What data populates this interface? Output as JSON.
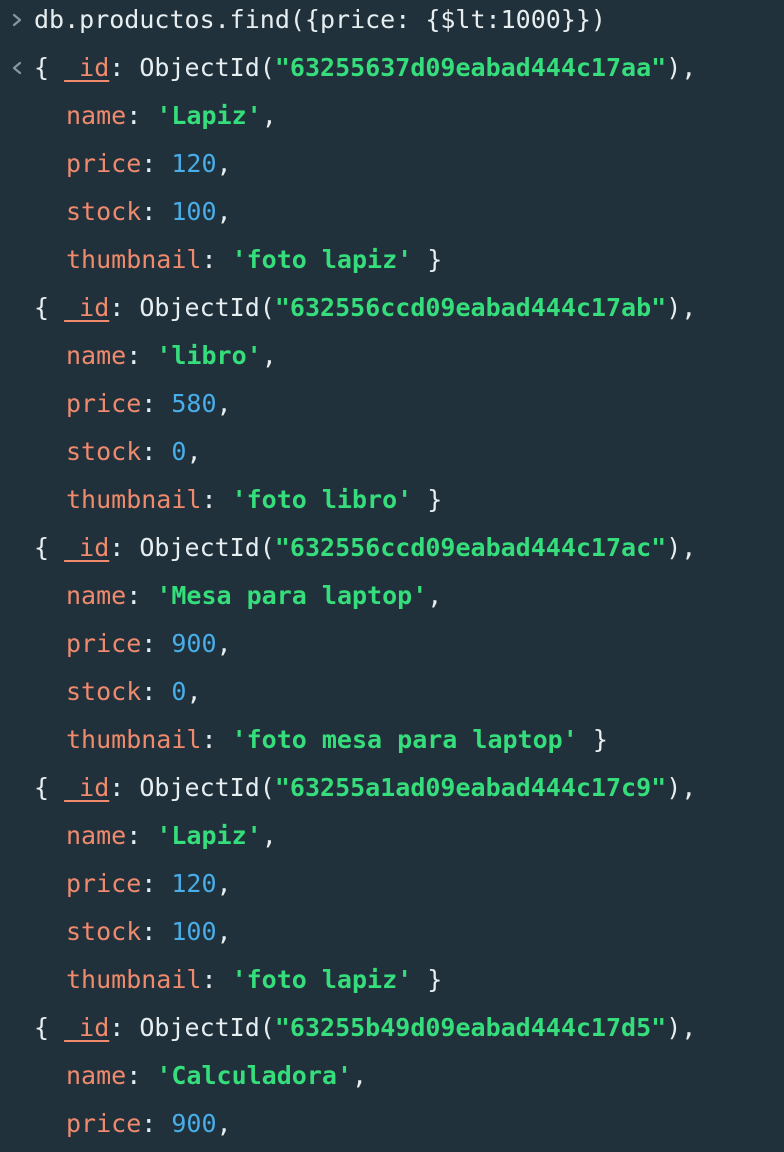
{
  "command": "db.productos.find({price: {$lt:1000}})",
  "colors": {
    "background": "#21313c",
    "key": "#ef8a6d",
    "string": "#35de7b",
    "number": "#48aee9",
    "text": "#e7eef0"
  },
  "icons": {
    "prompt": "chevron-right-icon",
    "result": "chevron-left-icon"
  },
  "documents": [
    {
      "id_key": "_id",
      "id_fn": "ObjectId",
      "id_value": "\"63255637d09eabad444c17aa\"",
      "fields": [
        {
          "key": "name",
          "value": "'Lapiz'",
          "type": "string",
          "tail": ","
        },
        {
          "key": "price",
          "value": "120",
          "type": "number",
          "tail": ","
        },
        {
          "key": "stock",
          "value": "100",
          "type": "number",
          "tail": ","
        },
        {
          "key": "thumbnail",
          "value": "'foto lapiz'",
          "type": "string",
          "tail": " }"
        }
      ]
    },
    {
      "id_key": "_id",
      "id_fn": "ObjectId",
      "id_value": "\"632556ccd09eabad444c17ab\"",
      "fields": [
        {
          "key": "name",
          "value": "'libro'",
          "type": "string",
          "tail": ","
        },
        {
          "key": "price",
          "value": "580",
          "type": "number",
          "tail": ","
        },
        {
          "key": "stock",
          "value": "0",
          "type": "number",
          "tail": ","
        },
        {
          "key": "thumbnail",
          "value": "'foto libro'",
          "type": "string",
          "tail": " }"
        }
      ]
    },
    {
      "id_key": "_id",
      "id_fn": "ObjectId",
      "id_value": "\"632556ccd09eabad444c17ac\"",
      "fields": [
        {
          "key": "name",
          "value": "'Mesa para laptop'",
          "type": "string",
          "tail": ","
        },
        {
          "key": "price",
          "value": "900",
          "type": "number",
          "tail": ","
        },
        {
          "key": "stock",
          "value": "0",
          "type": "number",
          "tail": ","
        },
        {
          "key": "thumbnail",
          "value": "'foto mesa para laptop'",
          "type": "string",
          "tail": " }"
        }
      ]
    },
    {
      "id_key": "_id",
      "id_fn": "ObjectId",
      "id_value": "\"63255a1ad09eabad444c17c9\"",
      "fields": [
        {
          "key": "name",
          "value": "'Lapiz'",
          "type": "string",
          "tail": ","
        },
        {
          "key": "price",
          "value": "120",
          "type": "number",
          "tail": ","
        },
        {
          "key": "stock",
          "value": "100",
          "type": "number",
          "tail": ","
        },
        {
          "key": "thumbnail",
          "value": "'foto lapiz'",
          "type": "string",
          "tail": " }"
        }
      ]
    },
    {
      "id_key": "_id",
      "id_fn": "ObjectId",
      "id_value": "\"63255b49d09eabad444c17d5\"",
      "fields": [
        {
          "key": "name",
          "value": "'Calculadora'",
          "type": "string",
          "tail": ","
        },
        {
          "key": "price",
          "value": "900",
          "type": "number",
          "tail": ","
        }
      ]
    }
  ]
}
